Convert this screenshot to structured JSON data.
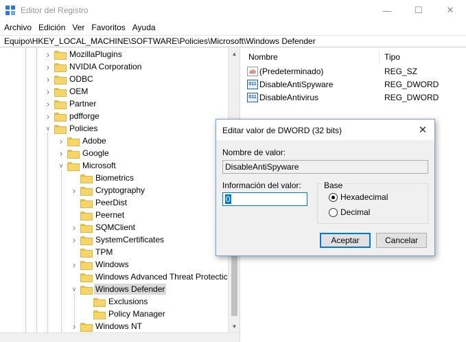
{
  "window": {
    "title": "Editor del Registro",
    "minimize_glyph": "—",
    "maximize_glyph": "☐",
    "close_glyph": "✕"
  },
  "menu": [
    "Archivo",
    "Edición",
    "Ver",
    "Favoritos",
    "Ayuda"
  ],
  "address": "Equipo\\HKEY_LOCAL_MACHINE\\SOFTWARE\\Policies\\Microsoft\\Windows Defender",
  "tree": [
    {
      "label": "MozillaPlugins",
      "level": 0,
      "expander": "collapsed"
    },
    {
      "label": "NVIDIA Corporation",
      "level": 0,
      "expander": "collapsed"
    },
    {
      "label": "ODBC",
      "level": 0,
      "expander": "collapsed"
    },
    {
      "label": "OEM",
      "level": 0,
      "expander": "collapsed"
    },
    {
      "label": "Partner",
      "level": 0,
      "expander": "collapsed"
    },
    {
      "label": "pdfforge",
      "level": 0,
      "expander": "collapsed"
    },
    {
      "label": "Policies",
      "level": 0,
      "expander": "expanded"
    },
    {
      "label": "Adobe",
      "level": 1,
      "expander": "collapsed"
    },
    {
      "label": "Google",
      "level": 1,
      "expander": "collapsed"
    },
    {
      "label": "Microsoft",
      "level": 1,
      "expander": "expanded"
    },
    {
      "label": "Biometrics",
      "level": 2,
      "expander": "none"
    },
    {
      "label": "Cryptography",
      "level": 2,
      "expander": "collapsed"
    },
    {
      "label": "PeerDist",
      "level": 2,
      "expander": "none"
    },
    {
      "label": "Peernet",
      "level": 2,
      "expander": "none"
    },
    {
      "label": "SQMClient",
      "level": 2,
      "expander": "collapsed"
    },
    {
      "label": "SystemCertificates",
      "level": 2,
      "expander": "collapsed"
    },
    {
      "label": "TPM",
      "level": 2,
      "expander": "none"
    },
    {
      "label": "Windows",
      "level": 2,
      "expander": "collapsed"
    },
    {
      "label": "Windows Advanced Threat Protectic",
      "level": 2,
      "expander": "none"
    },
    {
      "label": "Windows Defender",
      "level": 2,
      "expander": "expanded",
      "selected": true
    },
    {
      "label": "Exclusions",
      "level": 3,
      "expander": "none"
    },
    {
      "label": "Policy Manager",
      "level": 3,
      "expander": "none"
    },
    {
      "label": "Windows NT",
      "level": 2,
      "expander": "collapsed"
    }
  ],
  "list": {
    "col_name": "Nombre",
    "col_type": "Tipo",
    "rows": [
      {
        "name": "(Predeterminado)",
        "type": "REG_SZ",
        "icon": "string-value-icon",
        "glyph": "ab"
      },
      {
        "name": "DisableAntiSpyware",
        "type": "REG_DWORD",
        "icon": "dword-value-icon",
        "glyph": "011"
      },
      {
        "name": "DisableAntivirus",
        "type": "REG_DWORD",
        "icon": "dword-value-icon",
        "glyph": "011"
      }
    ]
  },
  "dialog": {
    "title": "Editar valor de DWORD (32 bits)",
    "close_glyph": "✕",
    "value_name_label": "Nombre de valor:",
    "value_name": "DisableAntiSpyware",
    "value_data_label": "Información del valor:",
    "value_data": "0",
    "base_label": "Base",
    "radio_hex": "Hexadecimal",
    "radio_dec": "Decimal",
    "selected_base": "hex",
    "ok": "Aceptar",
    "cancel": "Cancelar"
  }
}
